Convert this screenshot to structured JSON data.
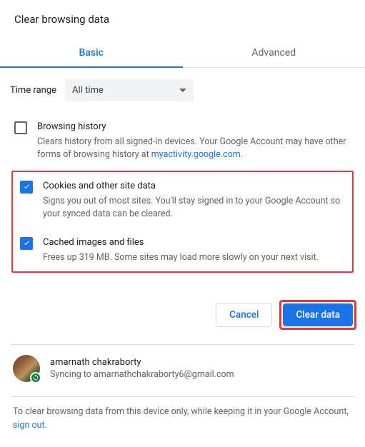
{
  "title": "Clear browsing data",
  "tabs": {
    "basic": "Basic",
    "advanced": "Advanced"
  },
  "time_range": {
    "label": "Time range",
    "value": "All time"
  },
  "items": {
    "history": {
      "title": "Browsing history",
      "desc_pre": "Clears history from all signed-in devices. Your Google Account may have other forms of browsing history at ",
      "link": "myactivity.google.com",
      "desc_post": "."
    },
    "cookies": {
      "title": "Cookies and other site data",
      "desc": "Signs you out of most sites. You'll stay signed in to your Google Account so your synced data can be cleared."
    },
    "cache": {
      "title": "Cached images and files",
      "desc": "Frees up 319 MB. Some sites may load more slowly on your next visit."
    }
  },
  "buttons": {
    "cancel": "Cancel",
    "clear": "Clear data"
  },
  "account": {
    "name": "amarnath chakraborty",
    "sync": "Syncing to amarnathchakraborty6@gmail.com"
  },
  "note_pre": "To clear browsing data from this device only, while keeping it in your Google Account, ",
  "note_link": "sign out",
  "note_post": "."
}
